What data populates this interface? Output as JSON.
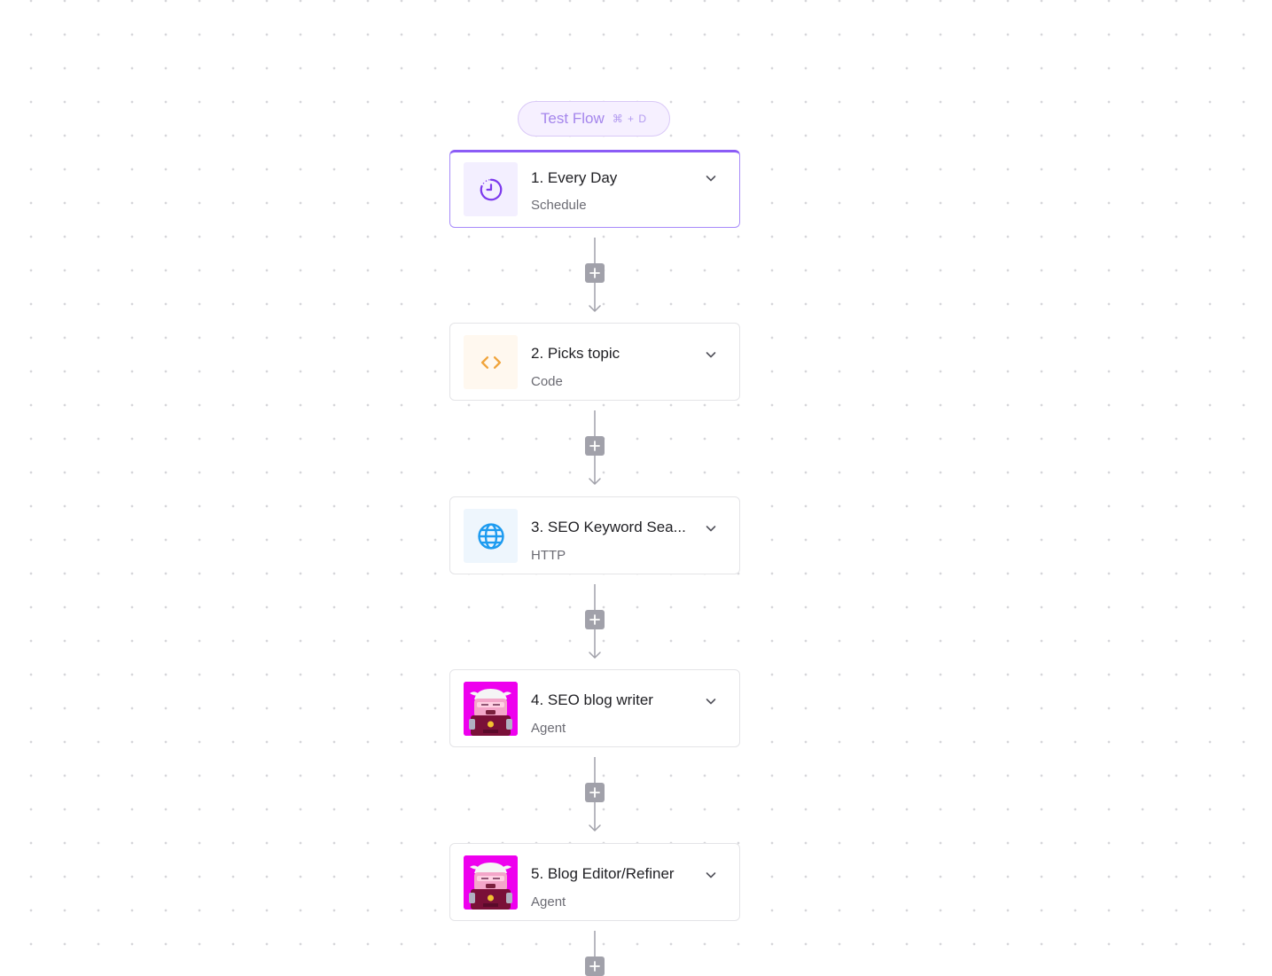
{
  "test_flow": {
    "label": "Test Flow",
    "shortcut": "⌘ + D"
  },
  "steps": [
    {
      "title": "1. Every Day",
      "subtitle": "Schedule",
      "icon": "clock-icon",
      "selected": true
    },
    {
      "title": "2. Picks topic",
      "subtitle": "Code",
      "icon": "code-icon"
    },
    {
      "title": "3. SEO Keyword Sea...",
      "subtitle": "HTTP",
      "icon": "globe-icon"
    },
    {
      "title": "4. SEO blog writer",
      "subtitle": "Agent",
      "icon": "agent-avatar-icon"
    },
    {
      "title": "5. Blog Editor/Refiner",
      "subtitle": "Agent",
      "icon": "agent-avatar-icon"
    }
  ],
  "colors": {
    "accent": "#8b5cf6",
    "schedule_icon_bg": "#f3efff",
    "code_icon_bg": "#fff8ef",
    "http_icon_bg": "#eef6fd",
    "agent_icon_bg": "#ee00ee",
    "connector": "#a1a1aa"
  }
}
